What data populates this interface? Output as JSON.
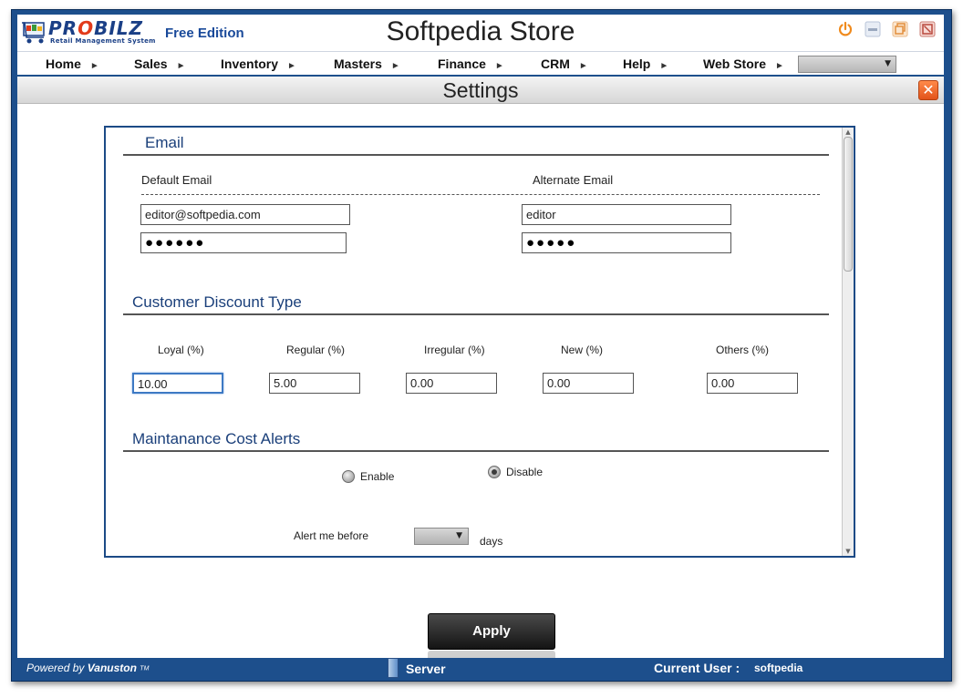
{
  "app": {
    "logo_text": "PROBILZ",
    "logo_subtitle": "Retail Management System",
    "edition": "Free Edition",
    "store_title": "Softpedia Store"
  },
  "nav": {
    "items": [
      {
        "label": "Home"
      },
      {
        "label": "Sales"
      },
      {
        "label": "Inventory"
      },
      {
        "label": "Masters"
      },
      {
        "label": "Finance"
      },
      {
        "label": "CRM"
      },
      {
        "label": "Help"
      },
      {
        "label": "Web Store"
      }
    ],
    "selector_value": ""
  },
  "settings": {
    "title": "Settings",
    "close_label": "✕"
  },
  "email": {
    "section_title": "Email",
    "default_label": "Default  Email",
    "alternate_label": "Alternate  Email",
    "default_value": "editor@softpedia.com",
    "default_password": "●●●●●●",
    "alternate_value": "editor",
    "alternate_password": "●●●●●"
  },
  "discount": {
    "section_title": "Customer Discount Type",
    "fields": [
      {
        "label": "Loyal  (%)",
        "value": "10.00"
      },
      {
        "label": "Regular  (%)",
        "value": "5.00"
      },
      {
        "label": "Irregular  (%)",
        "value": "0.00"
      },
      {
        "label": "New  (%)",
        "value": "0.00"
      },
      {
        "label": "Others  (%)",
        "value": "0.00"
      }
    ]
  },
  "maintenance": {
    "section_title": "Maintanance Cost Alerts",
    "enable_label": "Enable",
    "disable_label": "Disable",
    "selected": "Disable",
    "alert_label": "Alert me before",
    "days_label": "days",
    "days_value": ""
  },
  "actions": {
    "apply_label": "Apply"
  },
  "status": {
    "powered_prefix": "Powered by",
    "powered_brand": "Vanuston",
    "powered_tm": "TM",
    "server_label": "Server",
    "current_user_label": "Current User :",
    "current_user": "softpedia"
  },
  "colors": {
    "frame": "#1d4f8c",
    "section_title": "#1a3f7a",
    "close_button": "#e2531a",
    "focus_border": "#3d79c4"
  },
  "icons": {
    "power": "power-icon",
    "minimize": "minimize-icon",
    "restore": "restore-icon",
    "close": "close-window-icon",
    "cart": "shopping-cart-icon",
    "server": "server-icon"
  }
}
